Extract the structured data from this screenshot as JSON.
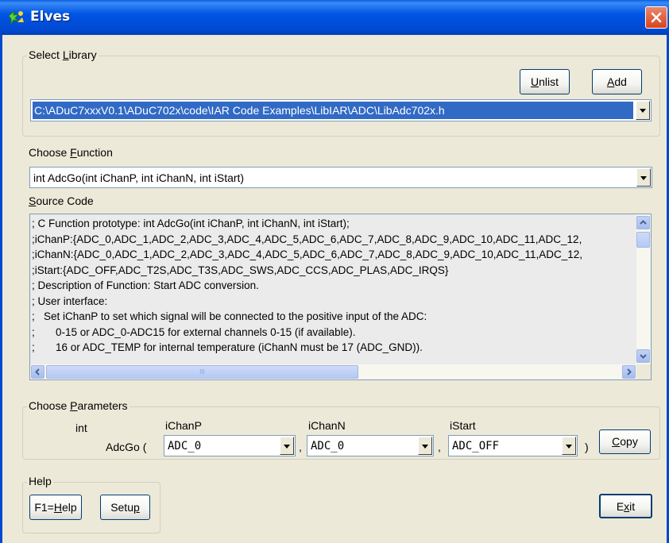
{
  "window": {
    "title": "Elves",
    "icon": "elves-app-icon",
    "close_icon": "close-icon",
    "title_color": "#0055e5",
    "close_color": "#d8431c"
  },
  "select_library": {
    "group_label_prefix": "Select ",
    "group_label_accel": "L",
    "group_label_suffix": "ibrary",
    "unlist_accel": "U",
    "unlist_rest": "nlist",
    "add_accel": "A",
    "add_rest": "dd",
    "library_path": "C:\\ADuC7xxxV0.1\\ADuC702x\\code\\IAR Code Examples\\LibIAR\\ADC\\LibAdc702x.h",
    "selection_color": "#316ac5"
  },
  "choose_function": {
    "label_prefix": "Choose ",
    "label_accel": "F",
    "label_suffix": "unction",
    "value": "int AdcGo(int iChanP, int iChanN, int iStart)"
  },
  "source_code": {
    "label_accel": "S",
    "label_rest": "ource Code",
    "lines": [
      "; C Function prototype: int AdcGo(int iChanP, int iChanN, int iStart);",
      ";iChanP:{ADC_0,ADC_1,ADC_2,ADC_3,ADC_4,ADC_5,ADC_6,ADC_7,ADC_8,ADC_9,ADC_10,ADC_11,ADC_12,",
      ";iChanN:{ADC_0,ADC_1,ADC_2,ADC_3,ADC_4,ADC_5,ADC_6,ADC_7,ADC_8,ADC_9,ADC_10,ADC_11,ADC_12,",
      ";iStart:{ADC_OFF,ADC_T2S,ADC_T3S,ADC_SWS,ADC_CCS,ADC_PLAS,ADC_IRQS}",
      "; Description of Function: Start ADC conversion.",
      "; User interface:",
      ";   Set iChanP to set which signal will be connected to the positive input of the ADC:",
      ";       0-15 or ADC_0-ADC15 for external channels 0-15 (if available).",
      ";       16 or ADC_TEMP for internal temperature (iChanN must be 17 (ADC_GND))."
    ],
    "hscroll_grip": "III"
  },
  "choose_parameters": {
    "label_prefix": "Choose ",
    "label_accel": "P",
    "label_suffix": "arameters",
    "return_type": "int",
    "function_name": "AdcGo (",
    "params": [
      {
        "name": "iChanP",
        "value": "ADC_0"
      },
      {
        "name": "iChanN",
        "value": "ADC_0"
      },
      {
        "name": "iStart",
        "value": "ADC_OFF"
      }
    ],
    "separator": ",",
    "close_paren": ")",
    "copy_accel": "C",
    "copy_rest": "opy"
  },
  "help": {
    "group_label": "Help",
    "f1_prefix": "F1=",
    "f1_accel": "H",
    "f1_suffix": "elp",
    "setup_prefix": "Setu",
    "setup_accel": "p",
    "exit_prefix": "E",
    "exit_accel": "x",
    "exit_suffix": "it"
  }
}
